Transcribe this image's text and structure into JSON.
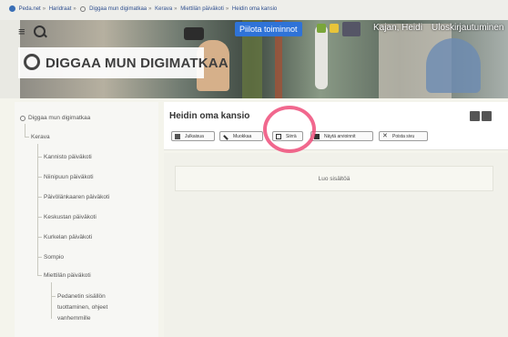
{
  "breadcrumb": [
    "Peda.net",
    "Haridraat",
    "Diggaa mun digimatkaa",
    "Kerava",
    "Miettilän päiväkoti",
    "Heidin oma kansio"
  ],
  "header": {
    "tools_button": "Piilota toiminnot",
    "user_name": "Kajan, Heidi",
    "logout": "Uloskirjautuminen",
    "logo_text": "DIGGAA MUN DIGIMATKAA"
  },
  "sidebar": {
    "root": "Diggaa mun digimatkaa",
    "level1": "Kerava",
    "items": [
      "Kannisto päiväkoti",
      "Niinipuun päiväkoti",
      "Päivölänkaaren päiväkoti",
      "Keskustan päiväkoti",
      "Kurkelan päiväkoti",
      "Sompio",
      "Miettilän päiväkoti"
    ],
    "child": [
      "Pedanetin sisällön",
      "tuottaminen, ohjeet",
      "vanhemmille"
    ]
  },
  "page": {
    "title": "Heidin oma kansio",
    "buttons": [
      "Julkaisua",
      "Muokkaa",
      "Siirrä",
      "Näytä arvioinnit",
      "Poista sivu"
    ],
    "create_content": "Luo sisältöä"
  },
  "colors": {
    "accent": "#2f73d8",
    "highlight": "#ef4d7a"
  }
}
